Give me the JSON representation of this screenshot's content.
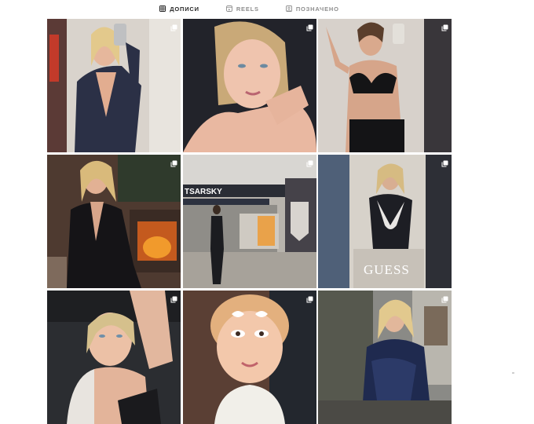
{
  "tabs": [
    {
      "label": "ДОПИСИ",
      "icon": "grid-icon",
      "active": true
    },
    {
      "label": "REELS",
      "icon": "reels-icon",
      "active": false
    },
    {
      "label": "ПОЗНАЧЕНО",
      "icon": "tagged-icon",
      "active": false
    }
  ],
  "posts": [
    {
      "id": "post-1",
      "kind": "carousel"
    },
    {
      "id": "post-2",
      "kind": "carousel"
    },
    {
      "id": "post-3",
      "kind": "carousel"
    },
    {
      "id": "post-4",
      "kind": "carousel"
    },
    {
      "id": "post-5",
      "kind": "carousel",
      "sign_text": "TSARSKY"
    },
    {
      "id": "post-6",
      "kind": "carousel",
      "sign_text": "GUESS"
    },
    {
      "id": "post-7",
      "kind": "carousel"
    },
    {
      "id": "post-8",
      "kind": "carousel"
    },
    {
      "id": "post-9",
      "kind": "carousel"
    }
  ],
  "colors": {
    "active_tab": "#262626",
    "inactive_tab": "#8e8e8e",
    "background": "#ffffff"
  }
}
